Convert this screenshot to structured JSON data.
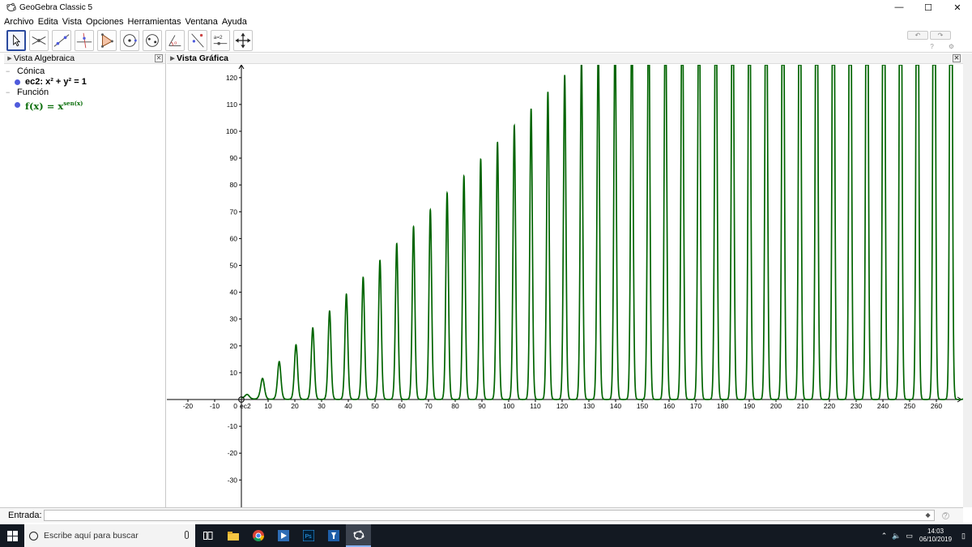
{
  "window": {
    "title": "GeoGebra Classic 5",
    "minimize": "—",
    "maximize": "☐",
    "close": "✕"
  },
  "menu": [
    "Archivo",
    "Edita",
    "Vista",
    "Opciones",
    "Herramientas",
    "Ventana",
    "Ayuda"
  ],
  "toolbar": {
    "tools": [
      "move-tool",
      "point-tool",
      "line-tool",
      "perpendicular-tool",
      "polygon-tool",
      "circle-center-tool",
      "conic-tool",
      "angle-tool",
      "reflect-tool",
      "slider-tool",
      "move-view-tool"
    ],
    "slider_tool_label": "a=2",
    "undo": "↶",
    "redo": "↷",
    "help": "?",
    "settings": "⚙"
  },
  "algebra_view": {
    "title": "Vista Algebraica",
    "groups": [
      {
        "label": "Cónica",
        "items": [
          {
            "text": "ec2: x² + y² = 1"
          }
        ]
      },
      {
        "label": "Función",
        "items": [
          {
            "base": "f(x) = x",
            "exponent": "sen(x)"
          }
        ]
      }
    ]
  },
  "graphics_view": {
    "title": "Vista Gráfica",
    "origin_label": "0",
    "conic_label": "ec2"
  },
  "input_bar": {
    "label": "Entrada:",
    "value": "",
    "help": "?"
  },
  "taskbar": {
    "search_placeholder": "Escribe aquí para buscar",
    "time": "14:03",
    "date": "06/10/2019"
  },
  "colors": {
    "curve": "#006400",
    "axes": "#000000",
    "dot": "#4f5bdc",
    "taskbar": "#131922"
  },
  "chart_data": {
    "type": "line",
    "function": "f(x) = x^sen(x)",
    "x_ticks": [
      -20,
      -10,
      0,
      10,
      20,
      30,
      40,
      50,
      60,
      70,
      80,
      90,
      100,
      110,
      120,
      130,
      140,
      150,
      160,
      170,
      180,
      190,
      200,
      210,
      220,
      230,
      240,
      250,
      260
    ],
    "y_ticks": [
      -30,
      -20,
      -10,
      10,
      20,
      30,
      40,
      50,
      60,
      70,
      80,
      90,
      100,
      110,
      120
    ],
    "xlim": [
      -27,
      270
    ],
    "ylim": [
      -40,
      125
    ],
    "grid": false
  }
}
